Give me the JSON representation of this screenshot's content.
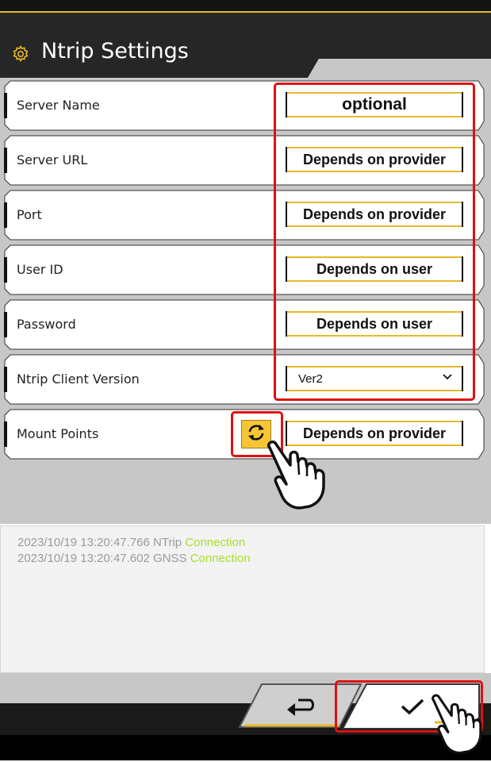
{
  "header": {
    "title": "Ntrip Settings",
    "icon": "gear-icon"
  },
  "rows": [
    {
      "label": "Server Name",
      "value": "optional"
    },
    {
      "label": "Server URL",
      "value": "Depends on provider"
    },
    {
      "label": "Port",
      "value": "Depends on provider"
    },
    {
      "label": "User ID",
      "value": "Depends on user"
    },
    {
      "label": "Password",
      "value": "Depends on user"
    },
    {
      "label": "Ntrip Client Version",
      "value": "Ver2"
    },
    {
      "label": "Mount Points",
      "value": "Depends on provider"
    }
  ],
  "log": [
    {
      "timestamp": "2023/10/19 13:20:47.766",
      "source": "NTrip",
      "status": "Connection"
    },
    {
      "timestamp": "2023/10/19 13:20:47.602",
      "source": "GNSS",
      "status": "Connection"
    }
  ],
  "footer": {
    "back_icon": "return-arrow-icon",
    "confirm_icon": "checkmark-icon"
  },
  "colors": {
    "accent": "#e7b928",
    "highlight": "#dd1111",
    "status_ok": "#a8de2c",
    "refresh_button": "#f5c535"
  }
}
